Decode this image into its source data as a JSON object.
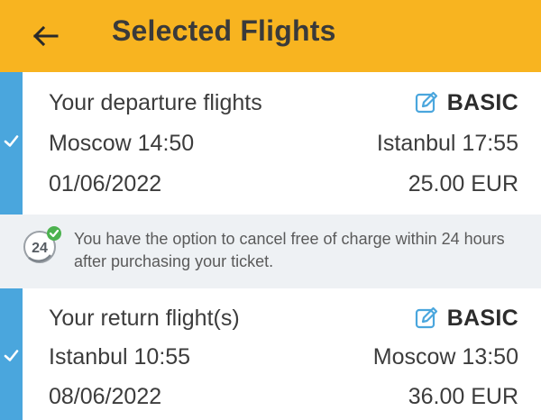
{
  "header": {
    "title": "Selected Flights",
    "back_icon": "arrow-left-icon",
    "background_color": "#f8b420"
  },
  "departure": {
    "heading": "Your departure flights",
    "fare_class": "BASIC",
    "fare_icon": "edit-icon",
    "origin": "Moscow 14:50",
    "destination": "Istanbul 17:55",
    "date": "01/06/2022",
    "price": "25.00 EUR",
    "selected": true
  },
  "notice": {
    "badge_icon": "24h-free-cancellation-icon",
    "badge_text": "24",
    "text": "You have the option to cancel free of charge within 24 hours after purchasing your ticket."
  },
  "return": {
    "heading": "Your return flight(s)",
    "fare_class": "BASIC",
    "fare_icon": "edit-icon",
    "origin": "Istanbul 10:55",
    "destination": "Moscow 13:50",
    "date": "08/06/2022",
    "price": "36.00 EUR",
    "selected": true
  },
  "colors": {
    "accent": "#4aa6dd",
    "notice_background": "#eef1f4",
    "check_green": "#4cb24f"
  }
}
